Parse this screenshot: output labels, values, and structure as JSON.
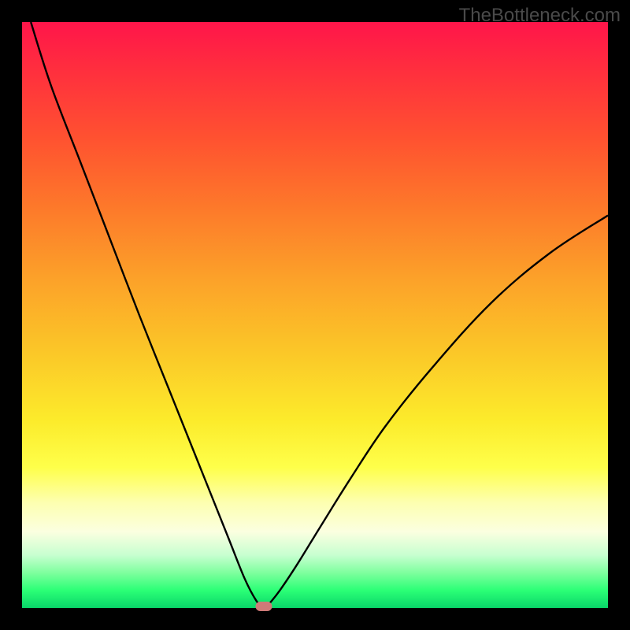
{
  "watermark": "TheBottleneck.com",
  "chart_data": {
    "type": "line",
    "title": "",
    "xlabel": "",
    "ylabel": "",
    "xlim": [
      0,
      100
    ],
    "ylim": [
      0,
      100
    ],
    "background_gradient": {
      "top": "#ff154a",
      "bottom": "#09d669",
      "description": "vertical rainbow gradient red→orange→yellow→green"
    },
    "series": [
      {
        "name": "bottleneck-curve",
        "color": "#000000",
        "x": [
          1.5,
          5,
          10,
          15,
          20,
          25,
          30,
          35,
          38,
          40,
          41,
          41.5,
          42,
          44,
          47,
          51,
          56,
          62,
          70,
          80,
          90,
          100
        ],
        "values": [
          100,
          89,
          76,
          63,
          50,
          37.5,
          25,
          12.5,
          5,
          1.2,
          0.3,
          0.1,
          0.5,
          3,
          7.5,
          14,
          22,
          31,
          41,
          52,
          60.5,
          67
        ]
      }
    ],
    "marker": {
      "x": 41.3,
      "y": 0.3,
      "color": "#cf7a78"
    }
  }
}
